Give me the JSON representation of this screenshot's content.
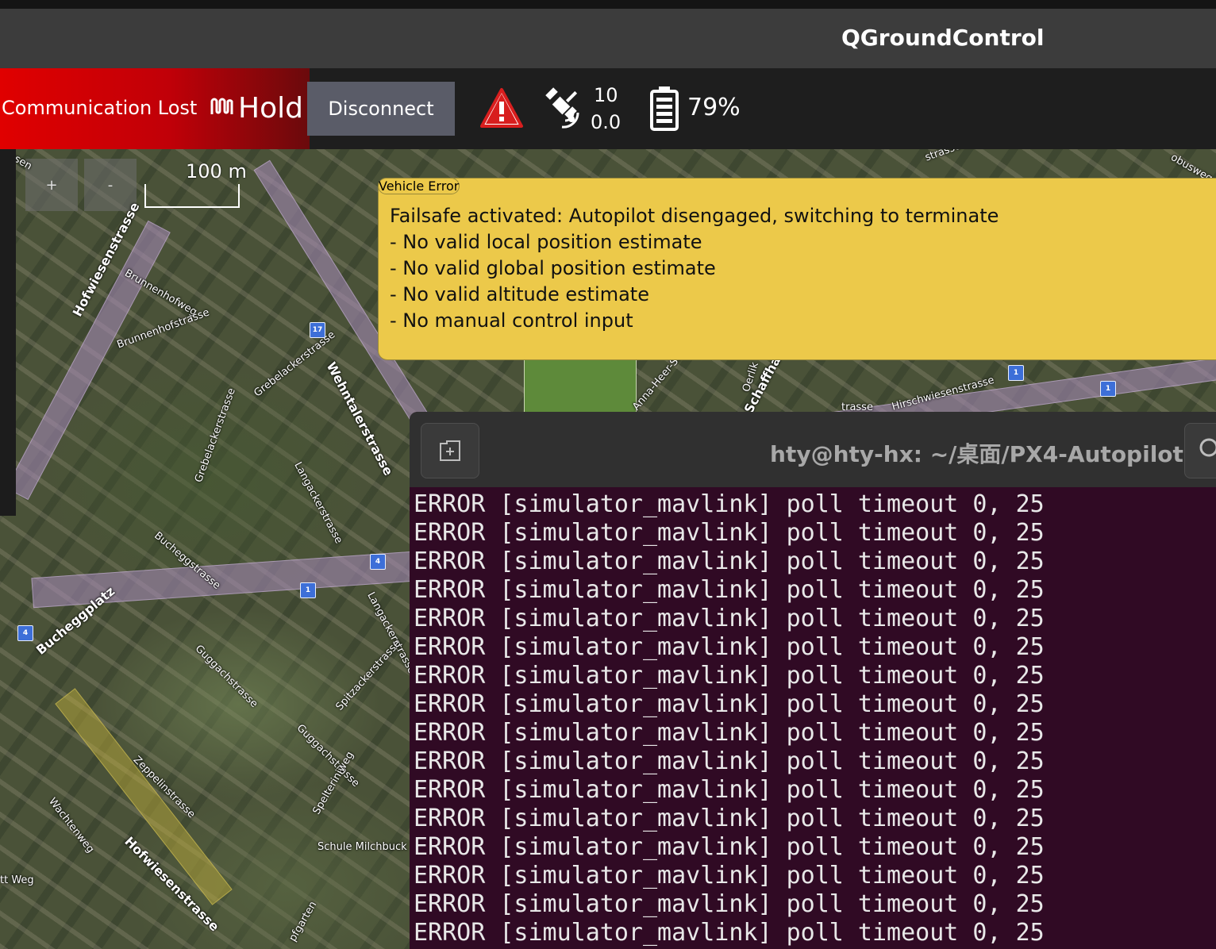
{
  "window": {
    "title": "QGroundControl"
  },
  "toolbar": {
    "status_text": "Communication Lost",
    "flight_mode": "Hold",
    "disconnect_label": "Disconnect",
    "gps": {
      "satellite_count": "10",
      "hdop": "0.0"
    },
    "battery_percent": "79%",
    "icons": {
      "mode": "flight-mode-icon",
      "warning": "warning-triangle-icon",
      "gps": "satellite-icon",
      "battery": "battery-icon"
    },
    "colors": {
      "alert_red": "#e00000",
      "button_bg": "#5a5c68",
      "warning_red": "#d81e1e"
    }
  },
  "map": {
    "scale_label": "100 m",
    "zoom_in_label": "+",
    "zoom_out_label": "-",
    "street_labels": [
      "Hofwiesenstrasse",
      "Brunnenhofweg",
      "Brunnenhofstrasse",
      "Wehntalerstrasse",
      "Grebelackerstrasse",
      "Grebelackerstrasse",
      "Langackerstrasse",
      "Bucheggstrasse",
      "Bucheggplatz",
      "Langackerstrasse",
      "Guggachstrasse",
      "Spitzackerstrasse",
      "Guggachstrasse",
      "Zeppelinstrasse",
      "Wachtenweg",
      "Hofwiesenstrasse",
      "Schule Milchbuck",
      "Spelteriniweg",
      "Anna-Heer-Stra",
      "Schaffhauser",
      "Oerlik",
      "Hirschwiesenstrasse",
      "trasse",
      "obusweg",
      "strasse",
      "tt Weg",
      "pfgarten",
      "esen"
    ],
    "route_badges": [
      "17",
      "4",
      "1",
      "4",
      "1",
      "1"
    ]
  },
  "vehicle_error": {
    "title": "Vehicle Error",
    "lines": [
      "Failsafe activated: Autopilot disengaged, switching to terminate",
      "- No valid local position estimate",
      "- No valid global position estimate",
      "- No valid altitude estimate",
      "- No manual control input"
    ],
    "background_color": "#ecc94a"
  },
  "terminal": {
    "title": "hty@hty-hx: ~/桌面/PX4-Autopilot",
    "background_color": "#300a24",
    "lines": [
      "ERROR [simulator_mavlink] poll timeout 0, 25",
      "ERROR [simulator_mavlink] poll timeout 0, 25",
      "ERROR [simulator_mavlink] poll timeout 0, 25",
      "ERROR [simulator_mavlink] poll timeout 0, 25",
      "ERROR [simulator_mavlink] poll timeout 0, 25",
      "ERROR [simulator_mavlink] poll timeout 0, 25",
      "ERROR [simulator_mavlink] poll timeout 0, 25",
      "ERROR [simulator_mavlink] poll timeout 0, 25",
      "ERROR [simulator_mavlink] poll timeout 0, 25",
      "ERROR [simulator_mavlink] poll timeout 0, 25",
      "ERROR [simulator_mavlink] poll timeout 0, 25",
      "ERROR [simulator_mavlink] poll timeout 0, 25",
      "ERROR [simulator_mavlink] poll timeout 0, 25",
      "ERROR [simulator_mavlink] poll timeout 0, 25",
      "ERROR [simulator_mavlink] poll timeout 0, 25",
      "ERROR [simulator_mavlink] poll timeout 0, 25"
    ]
  }
}
